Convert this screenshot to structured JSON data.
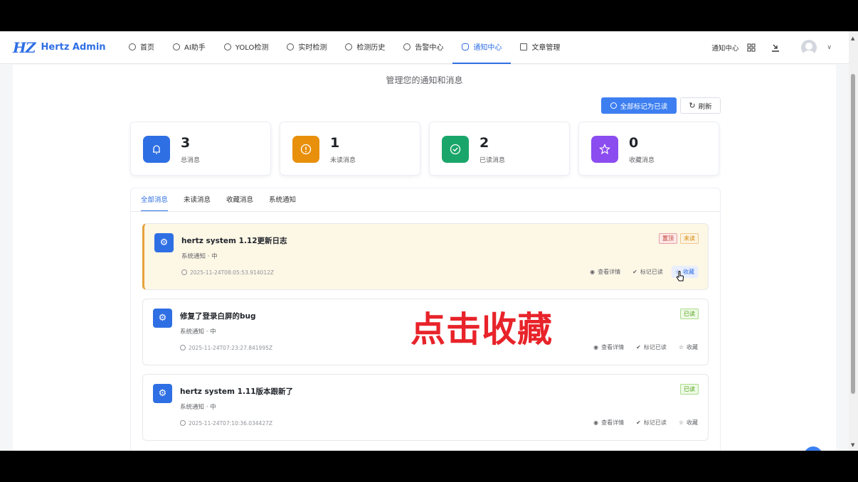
{
  "header": {
    "logo_mark": "HZ",
    "app_name": "Hertz Admin",
    "nav": [
      {
        "label": "首页",
        "icon": "home-icon"
      },
      {
        "label": "AI助手",
        "icon": "chat-icon"
      },
      {
        "label": "YOLO检测",
        "icon": "gauge-icon"
      },
      {
        "label": "实时检测",
        "icon": "gauge-icon"
      },
      {
        "label": "检测历史",
        "icon": "gauge-icon"
      },
      {
        "label": "告警中心",
        "icon": "gauge-icon"
      },
      {
        "label": "通知中心",
        "icon": "bell-icon",
        "active": true
      },
      {
        "label": "文章管理",
        "icon": "document-icon"
      }
    ],
    "breadcrumb": "通知中心",
    "icons": [
      "grid-icon",
      "download-icon",
      "avatar",
      "chevron-down-icon"
    ]
  },
  "page": {
    "subtitle": "管理您的通知和消息",
    "mark_all_read": "全部标记为已读",
    "refresh": "刷新"
  },
  "stats": [
    {
      "value": "3",
      "label": "总消息",
      "color": "#2f6fe4",
      "icon": "bell-icon"
    },
    {
      "value": "1",
      "label": "未读消息",
      "color": "#e8900c",
      "icon": "alert-icon"
    },
    {
      "value": "2",
      "label": "已读消息",
      "color": "#1aa66a",
      "icon": "check-circle-icon"
    },
    {
      "value": "0",
      "label": "收藏消息",
      "color": "#8b4cf0",
      "icon": "star-icon"
    }
  ],
  "tabs": [
    "全部消息",
    "未读消息",
    "收藏消息",
    "系统通知"
  ],
  "messages": [
    {
      "title": "hertz system 1.12更新日志",
      "meta": "系统通知 · 中",
      "time": "2025-11-24T08:05:53.914012Z",
      "tags": [
        "置顶",
        "未读"
      ],
      "unread": true
    },
    {
      "title": "修复了登录白屏的bug",
      "meta": "系统通知 · 中",
      "time": "2025-11-24T07:23:27.841995Z",
      "tags": [
        "已读"
      ],
      "unread": false
    },
    {
      "title": "hertz system 1.11版本跟新了",
      "meta": "系统通知 · 中",
      "time": "2025-11-24T07:10:36.034427Z",
      "tags": [
        "已读"
      ],
      "unread": false
    }
  ],
  "actions": {
    "view": "查看详情",
    "mark_read": "标记已读",
    "favorite": "收藏"
  },
  "overlay_caption": "点击收藏"
}
